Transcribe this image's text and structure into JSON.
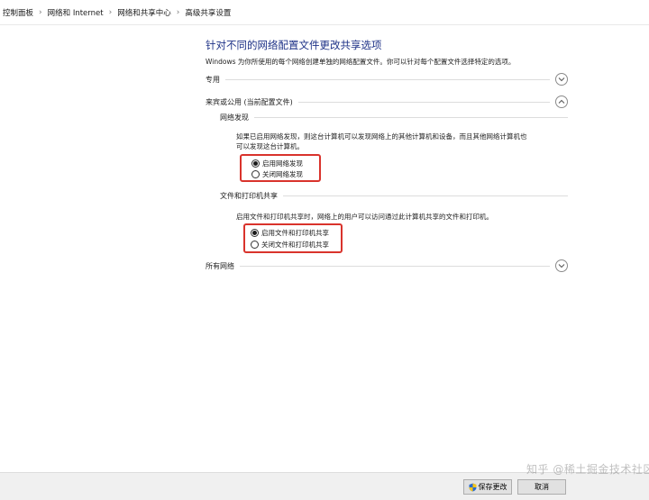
{
  "breadcrumb": {
    "items": [
      "控制面板",
      "网络和 Internet",
      "网络和共享中心",
      "高级共享设置"
    ],
    "separator": "›"
  },
  "main": {
    "title": "针对不同的网络配置文件更改共享选项",
    "description": "Windows 为你所使用的每个网络创建单独的网络配置文件。你可以针对每个配置文件选择特定的选项。"
  },
  "sections": {
    "private": {
      "label": "专用",
      "state": "collapsed"
    },
    "guest": {
      "label": "来宾或公用 (当前配置文件)",
      "state": "expanded",
      "discovery": {
        "heading": "网络发现",
        "description_line1": "如果已启用网络发现，则这台计算机可以发现网络上的其他计算机和设备，而且其他网络计算机也",
        "description_line2": "可以发现这台计算机。",
        "options": [
          "启用网络发现",
          "关闭网络发现"
        ],
        "selected": 0
      },
      "file_sharing": {
        "heading": "文件和打印机共享",
        "description": "启用文件和打印机共享时，网络上的用户可以访问通过此计算机共享的文件和打印机。",
        "options": [
          "启用文件和打印机共享",
          "关闭文件和打印机共享"
        ],
        "selected": 0
      }
    },
    "all_networks": {
      "label": "所有网络",
      "state": "collapsed"
    }
  },
  "footer": {
    "save_label": "保存更改",
    "cancel_label": "取消"
  },
  "watermark": "知乎 @稀土掘金技术社区",
  "colors": {
    "title": "#1e3287",
    "highlight_box": "#d9332c",
    "footer_bg": "#f0f0f0"
  }
}
